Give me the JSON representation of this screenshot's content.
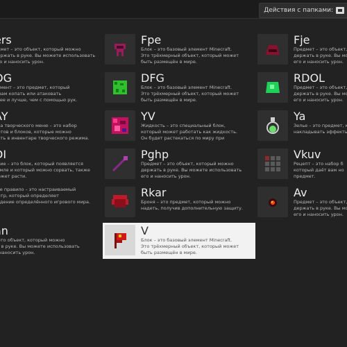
{
  "toolbar": {
    "folder_actions": "Действия с папками:"
  },
  "colors": {
    "background": "#222222",
    "selected": "#f2f2f2"
  },
  "left_column": [
    {
      "name": "ers",
      "desc": "едмет – это объект, который можно\nдержать в руке. Вы можете использовать\nего и наносить урон."
    },
    {
      "name": "OG",
      "desc": "румент – это предмет, который\nт вам копать или атаковать\nтрее и лучше, чем с помощью рук."
    },
    {
      "name": "AY",
      "desc": "дка творческого меню – это набор\nметов и блоков, которые можно\nдить в инвентаре творческого режима."
    },
    {
      "name": "DI",
      "desc": "ение – это блок, который появляется\nземле и который можно сорвать, также\nможет расти."
    },
    {
      "name": "",
      "desc": "вое правило – это настраиваемый\nметр, который определяет\nведение определённого игрового мира."
    },
    {
      "name": "an",
      "desc": "– это объект, который можно\nть в руке. Вы можете использовать\nи наносить урон."
    }
  ],
  "mid_column": [
    {
      "name": "Fpe",
      "icon": "helmet-icon",
      "desc": "Блок – это базовый элемент Minecraft.\nЭто трёхмерный объект, который может\nбыть размещён в мире."
    },
    {
      "name": "DFG",
      "icon": "green-block-icon",
      "desc": "Блок – это базовый элемент Minecraft.\nЭто трёхмерный объект, который может\nбыть размещён в мире."
    },
    {
      "name": "YV",
      "icon": "magenta-liquid-icon",
      "desc": "Жидкость – это специальный блок,\nкоторый может работать как жидкость.\nОн будет растекаться по миру при"
    },
    {
      "name": "Pghp",
      "icon": "wand-icon",
      "desc": "Предмет – это объект, который можно\nдержать в руке. Вы можете использовать\nего и наносить урон."
    },
    {
      "name": "Rkar",
      "icon": "armor-icon",
      "desc": "Броня – это предмет, который можно\nнадеть, получив дополнительную защиту."
    },
    {
      "name": "V",
      "icon": "red-flag-block-icon",
      "desc": "Блок – это базовый элемент Minecraft.\nЭто трёхмерный объект, который может\nбыть размещён в мире.",
      "selected": true
    }
  ],
  "right_column": [
    {
      "name": "Fje",
      "icon": "dark-red-helmet-icon",
      "desc": "Предмет – это объект, который\nдержать в руке. Вы можете и\nего и наносить урон."
    },
    {
      "name": "RDOL",
      "icon": "green-gem-icon",
      "desc": "Предмет – это объект, который\nдержать в руке. Вы можете и\nего и наносить урон."
    },
    {
      "name": "Ya",
      "icon": "potion-icon",
      "desc": "Зелье – это предмет, который\nнакладывать эффекты"
    },
    {
      "name": "Vkuv",
      "icon": "recipe-grid-icon",
      "desc": "Рецепт – это набор б\nкоторый даёт вам но\nпредмет."
    },
    {
      "name": "Av",
      "icon": "fire-orb-icon",
      "desc": "Предмет – это объект, который\nдержать в руке. Вы можете и\nего и наносить урон."
    }
  ]
}
